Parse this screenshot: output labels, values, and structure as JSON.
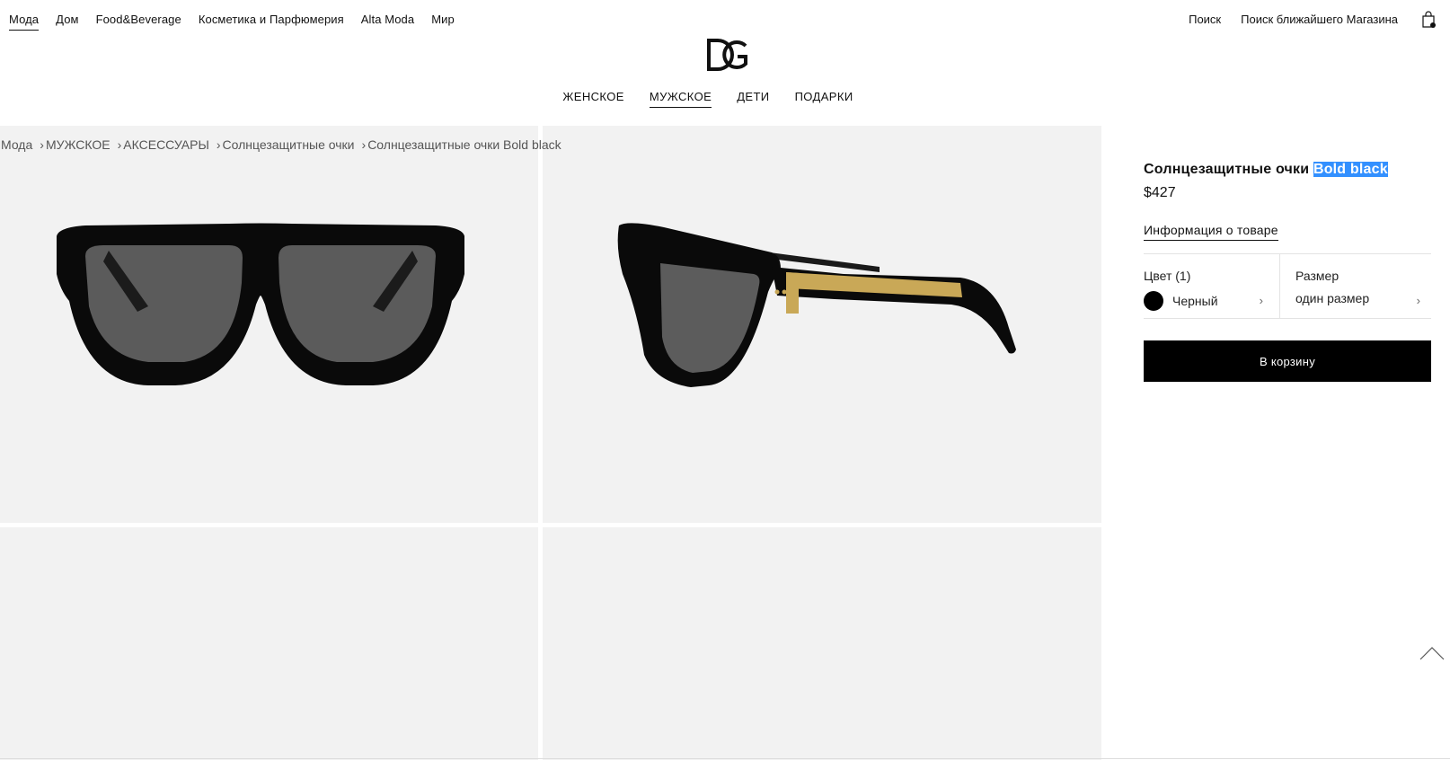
{
  "top_nav": {
    "items": [
      "Мода",
      "Дом",
      "Food&Beverage",
      "Косметика и Парфюмерия",
      "Alta Moda",
      "Мир"
    ],
    "active": "Мода"
  },
  "utility": {
    "search": "Поиск",
    "store_locator": "Поиск ближайшего Магазина",
    "bag_icon": "shopping-bag-icon"
  },
  "logo_text": "DG",
  "main_nav": {
    "items": [
      "ЖЕНСКОЕ",
      "МУЖСКОЕ",
      "ДЕТИ",
      "ПОДАРКИ"
    ],
    "active": "МУЖСКОЕ"
  },
  "breadcrumb": [
    "Мода",
    "МУЖСКОЕ",
    "АКСЕССУАРЫ",
    "Солнцезащитные очки",
    "Солнцезащитные очки Bold black"
  ],
  "product": {
    "title_prefix": "Солнцезащитные очки ",
    "title_highlight": "Bold black",
    "price": "$427",
    "info_link": "Информация о товаре",
    "color_label": "Цвет (1)",
    "color_value": "Черный",
    "color_swatch": "#000000",
    "size_label": "Размер",
    "size_value": "один размер",
    "add_to_cart": "В корзину"
  },
  "colors": {
    "tile_bg": "#f2f2f2",
    "selection_highlight": "#3390ff",
    "button_bg": "#000000",
    "frame_gold": "#c9a857"
  }
}
